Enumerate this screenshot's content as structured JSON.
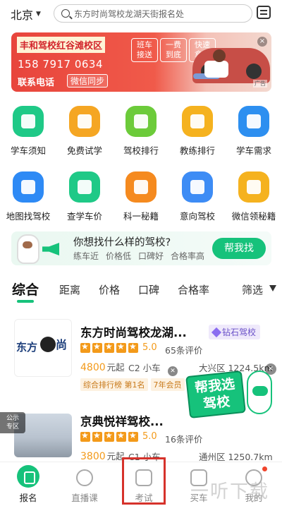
{
  "header": {
    "city": "北京",
    "search_placeholder": "东方时尚驾校龙湖天街报名处"
  },
  "banner": {
    "title": "丰和驾校红谷滩校区",
    "phone": "158 7917 0634",
    "contact_label": "联系电话",
    "wechat_label": "微信同步",
    "tags": [
      "班车\n接送",
      "一费\n到底",
      "快速\n拿证"
    ],
    "ad_label": "广告",
    "close_label": "×"
  },
  "grid": [
    {
      "label": "学车须知",
      "icon": "notice-icon",
      "color": "#1fc987"
    },
    {
      "label": "免费试学",
      "icon": "trial-gift-icon",
      "color": "#f5a623"
    },
    {
      "label": "驾校排行",
      "icon": "trophy-icon",
      "color": "#6ccb3a"
    },
    {
      "label": "教练排行",
      "icon": "coach-icon",
      "color": "#f5b21f"
    },
    {
      "label": "学车需求",
      "icon": "form-icon",
      "color": "#2d8ff0"
    },
    {
      "label": "地图找驾校",
      "icon": "map-icon",
      "color": "#2e8af5"
    },
    {
      "label": "查学车价",
      "icon": "price-icon",
      "color": "#1fc987"
    },
    {
      "label": "科一秘籍",
      "icon": "pen-book-icon",
      "color": "#f58a1f"
    },
    {
      "label": "意向驾校",
      "icon": "star-icon",
      "color": "#3d8cf5"
    },
    {
      "label": "微信领秘籍",
      "icon": "book-icon",
      "color": "#f5b21f"
    }
  ],
  "promo": {
    "question": "你想找什么样的驾校?",
    "options": [
      "练车近",
      "价格低",
      "口碑好",
      "合格率高"
    ],
    "button": "帮我找"
  },
  "tabs": {
    "items": [
      "综合",
      "距离",
      "价格",
      "口碑",
      "合格率"
    ],
    "active_index": 0,
    "filter": "筛选"
  },
  "schools": [
    {
      "name": "东方时尚驾校龙湖...",
      "badge": "钻石驾校",
      "rating": 5.0,
      "score": "5.0",
      "reviews": "65条评价",
      "price": "4800",
      "price_unit": "元起",
      "class": "C2 小车",
      "distance": "大兴区 1224.5km",
      "tags": [
        "综合排行榜 第1名",
        "7年会员"
      ]
    },
    {
      "name": "京典悦祥驾校...",
      "rating": 5.0,
      "score": "5.0",
      "reviews": "16条评价",
      "price": "3800",
      "price_unit": "元起",
      "class": "C1 小车",
      "distance": "通州区 1250.7km"
    }
  ],
  "float_ad": {
    "text": "帮我选驾校",
    "close_label": "×"
  },
  "side_tag": "公示\n专区",
  "bottom_nav": {
    "items": [
      {
        "label": "报名",
        "icon": "signup-icon"
      },
      {
        "label": "直播课",
        "icon": "live-play-icon"
      },
      {
        "label": "考试",
        "icon": "exam-icon"
      },
      {
        "label": "买车",
        "icon": "car-icon"
      },
      {
        "label": "我的",
        "icon": "profile-icon"
      }
    ],
    "active_index": 0
  },
  "watermark": "一听下载",
  "colors": {
    "accent": "#16c27b",
    "price": "#f39a1a",
    "highlight": "#d6322b"
  }
}
